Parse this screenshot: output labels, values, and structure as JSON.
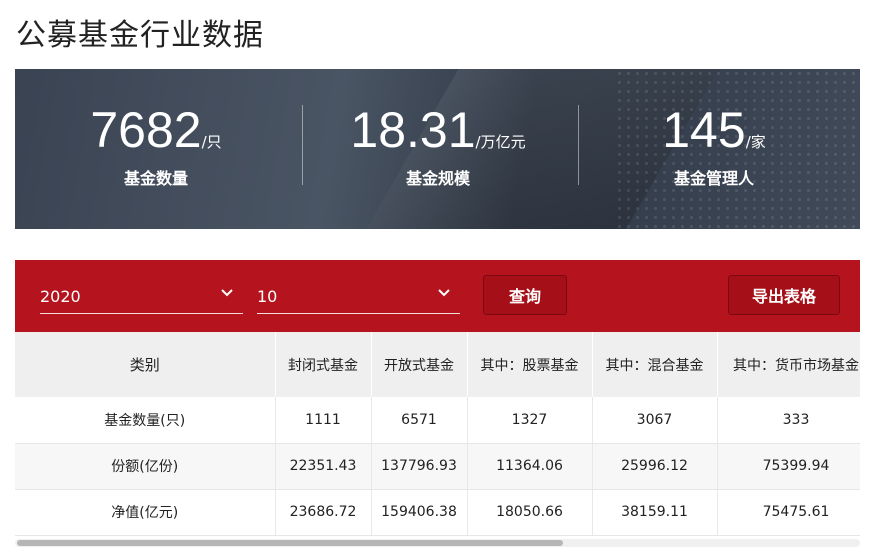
{
  "page": {
    "title": "公募基金行业数据"
  },
  "stats": [
    {
      "value": "7682",
      "unit": "/只",
      "label": "基金数量"
    },
    {
      "value": "18.31",
      "unit": "/万亿元",
      "label": "基金规模"
    },
    {
      "value": "145",
      "unit": "/家",
      "label": "基金管理人"
    }
  ],
  "filters": {
    "year": "2020",
    "month": "10",
    "query_label": "查询",
    "export_label": "导出表格"
  },
  "table": {
    "headers": [
      "类别",
      "封闭式基金",
      "开放式基金",
      "其中：股票基金",
      "其中：混合基金",
      "其中：货币市场基金"
    ],
    "rows": [
      [
        "基金数量(只)",
        "1111",
        "6571",
        "1327",
        "3067",
        "333"
      ],
      [
        "份额(亿份)",
        "22351.43",
        "137796.93",
        "11364.06",
        "25996.12",
        "75399.94"
      ],
      [
        "净值(亿元)",
        "23686.72",
        "159406.38",
        "18050.66",
        "38159.11",
        "75475.61"
      ]
    ]
  }
}
